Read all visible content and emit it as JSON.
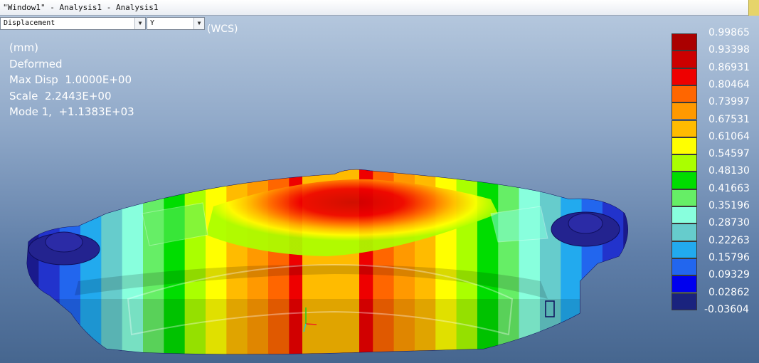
{
  "window": {
    "title": "\"Window1\" - Analysis1 - Analysis1"
  },
  "toolbar": {
    "result_select": {
      "value": "Displacement"
    },
    "component_select": {
      "value": "Y"
    },
    "coord_system_label": "(WCS)"
  },
  "info": {
    "units": "(mm)",
    "state": "Deformed",
    "max_disp": "Max Disp  1.0000E+00",
    "scale": "Scale  2.2443E+00",
    "mode": "Mode 1,  +1.1383E+03"
  },
  "legend": {
    "labels": [
      "0.99865",
      "0.93398",
      "0.86931",
      "0.80464",
      "0.73997",
      "0.67531",
      "0.61064",
      "0.54597",
      "0.48130",
      "0.41663",
      "0.35196",
      "0.28730",
      "0.22263",
      "0.15796",
      "0.09329",
      "0.02862",
      "-0.03604"
    ],
    "colors": [
      "#aa0000",
      "#cc0000",
      "#ee0000",
      "#ff6600",
      "#ff9900",
      "#ffbb00",
      "#ffff00",
      "#aaff00",
      "#00dd00",
      "#66ee66",
      "#88ffdd",
      "#66cccc",
      "#22aaee",
      "#2266ee",
      "#0000ee",
      "#1a237e"
    ]
  },
  "model": {
    "band_colors": [
      "#1a1a8c",
      "#2233cc",
      "#2266ee",
      "#22aaee",
      "#66cccc",
      "#88ffdd",
      "#66ee66",
      "#00dd00",
      "#aaff00",
      "#ffff00",
      "#ffbb00",
      "#ff9900",
      "#ff6600",
      "#ee0000",
      "#cc0000"
    ]
  }
}
